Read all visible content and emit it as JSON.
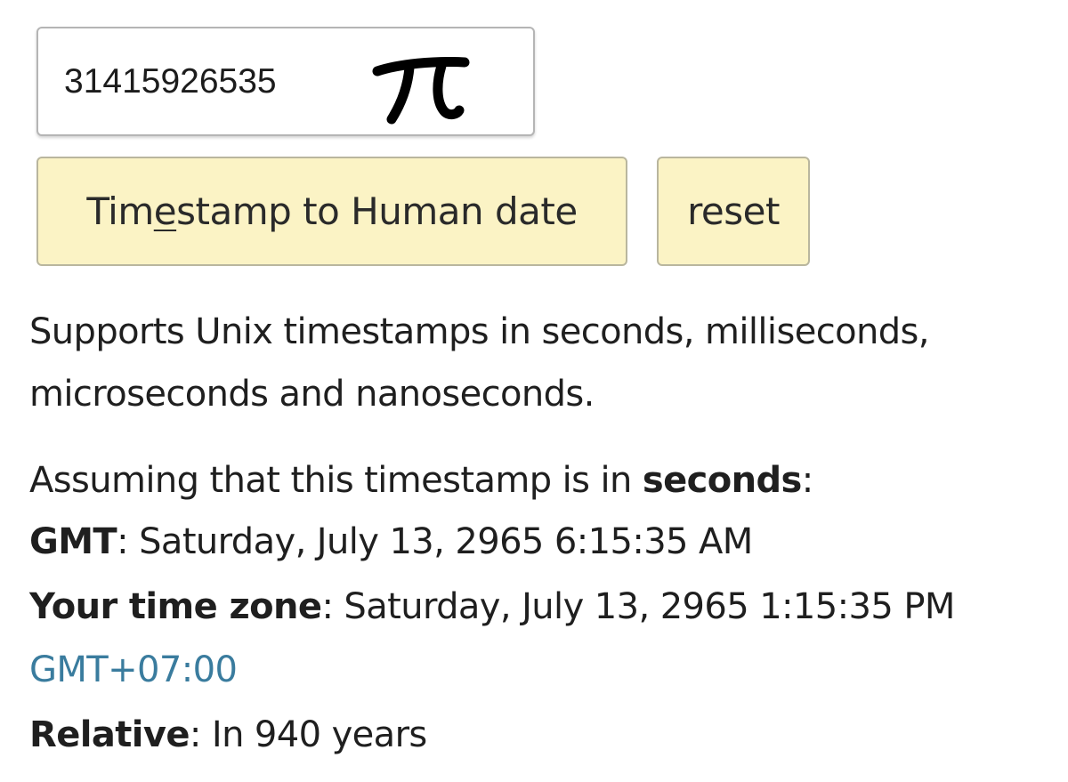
{
  "input": {
    "value": "31415926535",
    "annotation": "π"
  },
  "buttons": {
    "convert_prefix": "Tim",
    "convert_underlined": "e",
    "convert_suffix": "stamp to Human date",
    "reset_label": "reset"
  },
  "info": {
    "line1": "Supports Unix timestamps in seconds, milliseconds,",
    "line2": "microseconds and nanoseconds."
  },
  "result": {
    "assume_prefix": "Assuming that this timestamp is in ",
    "assume_unit": "seconds",
    "assume_suffix": ":",
    "gmt_label": "GMT",
    "gmt_value": ": Saturday, July 13, 2965 6:15:35 AM",
    "tz_label": "Your time zone",
    "tz_value": ": Saturday, July 13, 2965 1:15:35 PM",
    "tz_offset": "GMT+07:00",
    "relative_label": "Relative",
    "relative_value": ": In 940 years"
  },
  "colors": {
    "button_bg": "#fbf3c5",
    "link": "#3a7c9e"
  }
}
